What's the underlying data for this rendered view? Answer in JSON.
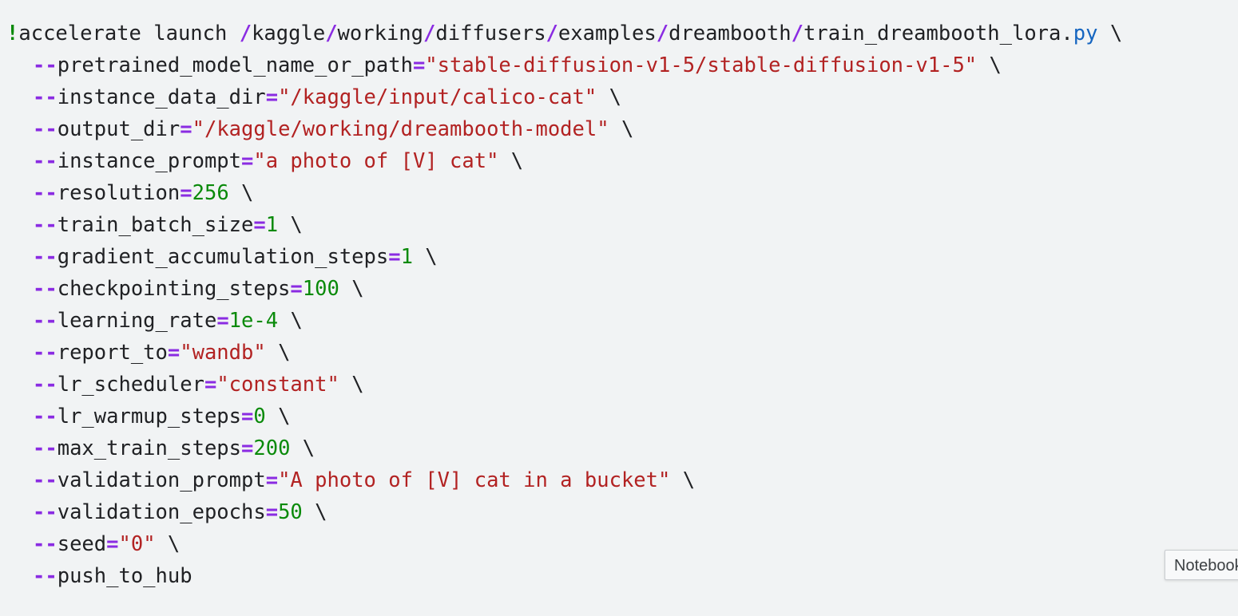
{
  "code_cell": {
    "lines": [
      {
        "segments": [
          {
            "t": "!",
            "c": "bang"
          },
          {
            "t": "accelerate launch ",
            "c": "plain"
          },
          {
            "t": "/",
            "c": "op"
          },
          {
            "t": "kaggle",
            "c": "plain"
          },
          {
            "t": "/",
            "c": "op"
          },
          {
            "t": "working",
            "c": "plain"
          },
          {
            "t": "/",
            "c": "op"
          },
          {
            "t": "diffusers",
            "c": "plain"
          },
          {
            "t": "/",
            "c": "op"
          },
          {
            "t": "examples",
            "c": "plain"
          },
          {
            "t": "/",
            "c": "op"
          },
          {
            "t": "dreambooth",
            "c": "plain"
          },
          {
            "t": "/",
            "c": "op"
          },
          {
            "t": "train_dreambooth_lora",
            "c": "plain"
          },
          {
            "t": ".",
            "c": "plain"
          },
          {
            "t": "py",
            "c": "attr"
          },
          {
            "t": " \\",
            "c": "plain"
          }
        ]
      },
      {
        "indent": true,
        "segments": [
          {
            "t": "--",
            "c": "op"
          },
          {
            "t": "pretrained_model_name_or_path",
            "c": "plain"
          },
          {
            "t": "=",
            "c": "op"
          },
          {
            "t": "\"stable-diffusion-v1-5/stable-diffusion-v1-5\"",
            "c": "str"
          },
          {
            "t": " \\",
            "c": "plain"
          }
        ]
      },
      {
        "indent": true,
        "segments": [
          {
            "t": "--",
            "c": "op"
          },
          {
            "t": "instance_data_dir",
            "c": "plain"
          },
          {
            "t": "=",
            "c": "op"
          },
          {
            "t": "\"/kaggle/input/calico-cat\"",
            "c": "str"
          },
          {
            "t": " \\",
            "c": "plain"
          }
        ]
      },
      {
        "indent": true,
        "segments": [
          {
            "t": "--",
            "c": "op"
          },
          {
            "t": "output_dir",
            "c": "plain"
          },
          {
            "t": "=",
            "c": "op"
          },
          {
            "t": "\"/kaggle/working/dreambooth-model\"",
            "c": "str"
          },
          {
            "t": " \\",
            "c": "plain"
          }
        ]
      },
      {
        "indent": true,
        "segments": [
          {
            "t": "--",
            "c": "op"
          },
          {
            "t": "instance_prompt",
            "c": "plain"
          },
          {
            "t": "=",
            "c": "op"
          },
          {
            "t": "\"a photo of [V] cat\"",
            "c": "str"
          },
          {
            "t": " \\",
            "c": "plain"
          }
        ]
      },
      {
        "indent": true,
        "segments": [
          {
            "t": "--",
            "c": "op"
          },
          {
            "t": "resolution",
            "c": "plain"
          },
          {
            "t": "=",
            "c": "op"
          },
          {
            "t": "256",
            "c": "num"
          },
          {
            "t": " \\",
            "c": "plain"
          }
        ]
      },
      {
        "indent": true,
        "segments": [
          {
            "t": "--",
            "c": "op"
          },
          {
            "t": "train_batch_size",
            "c": "plain"
          },
          {
            "t": "=",
            "c": "op"
          },
          {
            "t": "1",
            "c": "num"
          },
          {
            "t": " \\",
            "c": "plain"
          }
        ]
      },
      {
        "indent": true,
        "segments": [
          {
            "t": "--",
            "c": "op"
          },
          {
            "t": "gradient_accumulation_steps",
            "c": "plain"
          },
          {
            "t": "=",
            "c": "op"
          },
          {
            "t": "1",
            "c": "num"
          },
          {
            "t": " \\",
            "c": "plain"
          }
        ]
      },
      {
        "indent": true,
        "segments": [
          {
            "t": "--",
            "c": "op"
          },
          {
            "t": "checkpointing_steps",
            "c": "plain"
          },
          {
            "t": "=",
            "c": "op"
          },
          {
            "t": "100",
            "c": "num"
          },
          {
            "t": " \\",
            "c": "plain"
          }
        ]
      },
      {
        "indent": true,
        "segments": [
          {
            "t": "--",
            "c": "op"
          },
          {
            "t": "learning_rate",
            "c": "plain"
          },
          {
            "t": "=",
            "c": "op"
          },
          {
            "t": "1e-4",
            "c": "num"
          },
          {
            "t": " \\",
            "c": "plain"
          }
        ]
      },
      {
        "indent": true,
        "segments": [
          {
            "t": "--",
            "c": "op"
          },
          {
            "t": "report_to",
            "c": "plain"
          },
          {
            "t": "=",
            "c": "op"
          },
          {
            "t": "\"wandb\"",
            "c": "str"
          },
          {
            "t": " \\",
            "c": "plain"
          }
        ]
      },
      {
        "indent": true,
        "segments": [
          {
            "t": "--",
            "c": "op"
          },
          {
            "t": "lr_scheduler",
            "c": "plain"
          },
          {
            "t": "=",
            "c": "op"
          },
          {
            "t": "\"constant\"",
            "c": "str"
          },
          {
            "t": " \\",
            "c": "plain"
          }
        ]
      },
      {
        "indent": true,
        "segments": [
          {
            "t": "--",
            "c": "op"
          },
          {
            "t": "lr_warmup_steps",
            "c": "plain"
          },
          {
            "t": "=",
            "c": "op"
          },
          {
            "t": "0",
            "c": "num"
          },
          {
            "t": " \\",
            "c": "plain"
          }
        ]
      },
      {
        "indent": true,
        "segments": [
          {
            "t": "--",
            "c": "op"
          },
          {
            "t": "max_train_steps",
            "c": "plain"
          },
          {
            "t": "=",
            "c": "op"
          },
          {
            "t": "200",
            "c": "num"
          },
          {
            "t": " \\",
            "c": "plain"
          }
        ]
      },
      {
        "indent": true,
        "segments": [
          {
            "t": "--",
            "c": "op"
          },
          {
            "t": "validation_prompt",
            "c": "plain"
          },
          {
            "t": "=",
            "c": "op"
          },
          {
            "t": "\"A photo of [V] cat in a bucket\"",
            "c": "str"
          },
          {
            "t": " \\",
            "c": "plain"
          }
        ]
      },
      {
        "indent": true,
        "segments": [
          {
            "t": "--",
            "c": "op"
          },
          {
            "t": "validation_epochs",
            "c": "plain"
          },
          {
            "t": "=",
            "c": "op"
          },
          {
            "t": "50",
            "c": "num"
          },
          {
            "t": " \\",
            "c": "plain"
          }
        ]
      },
      {
        "indent": true,
        "segments": [
          {
            "t": "--",
            "c": "op"
          },
          {
            "t": "seed",
            "c": "plain"
          },
          {
            "t": "=",
            "c": "op"
          },
          {
            "t": "\"0\"",
            "c": "str"
          },
          {
            "t": " \\",
            "c": "plain"
          }
        ]
      },
      {
        "indent": true,
        "segments": [
          {
            "t": "--",
            "c": "op"
          },
          {
            "t": "push_to_hub",
            "c": "plain"
          }
        ]
      }
    ]
  },
  "tooltip": {
    "text": "Notebook"
  },
  "colors": {
    "background": "#f1f3f4",
    "operator": "#8a2be2",
    "string": "#b22222",
    "number": "#0a8a0a",
    "attribute": "#1565c0"
  }
}
